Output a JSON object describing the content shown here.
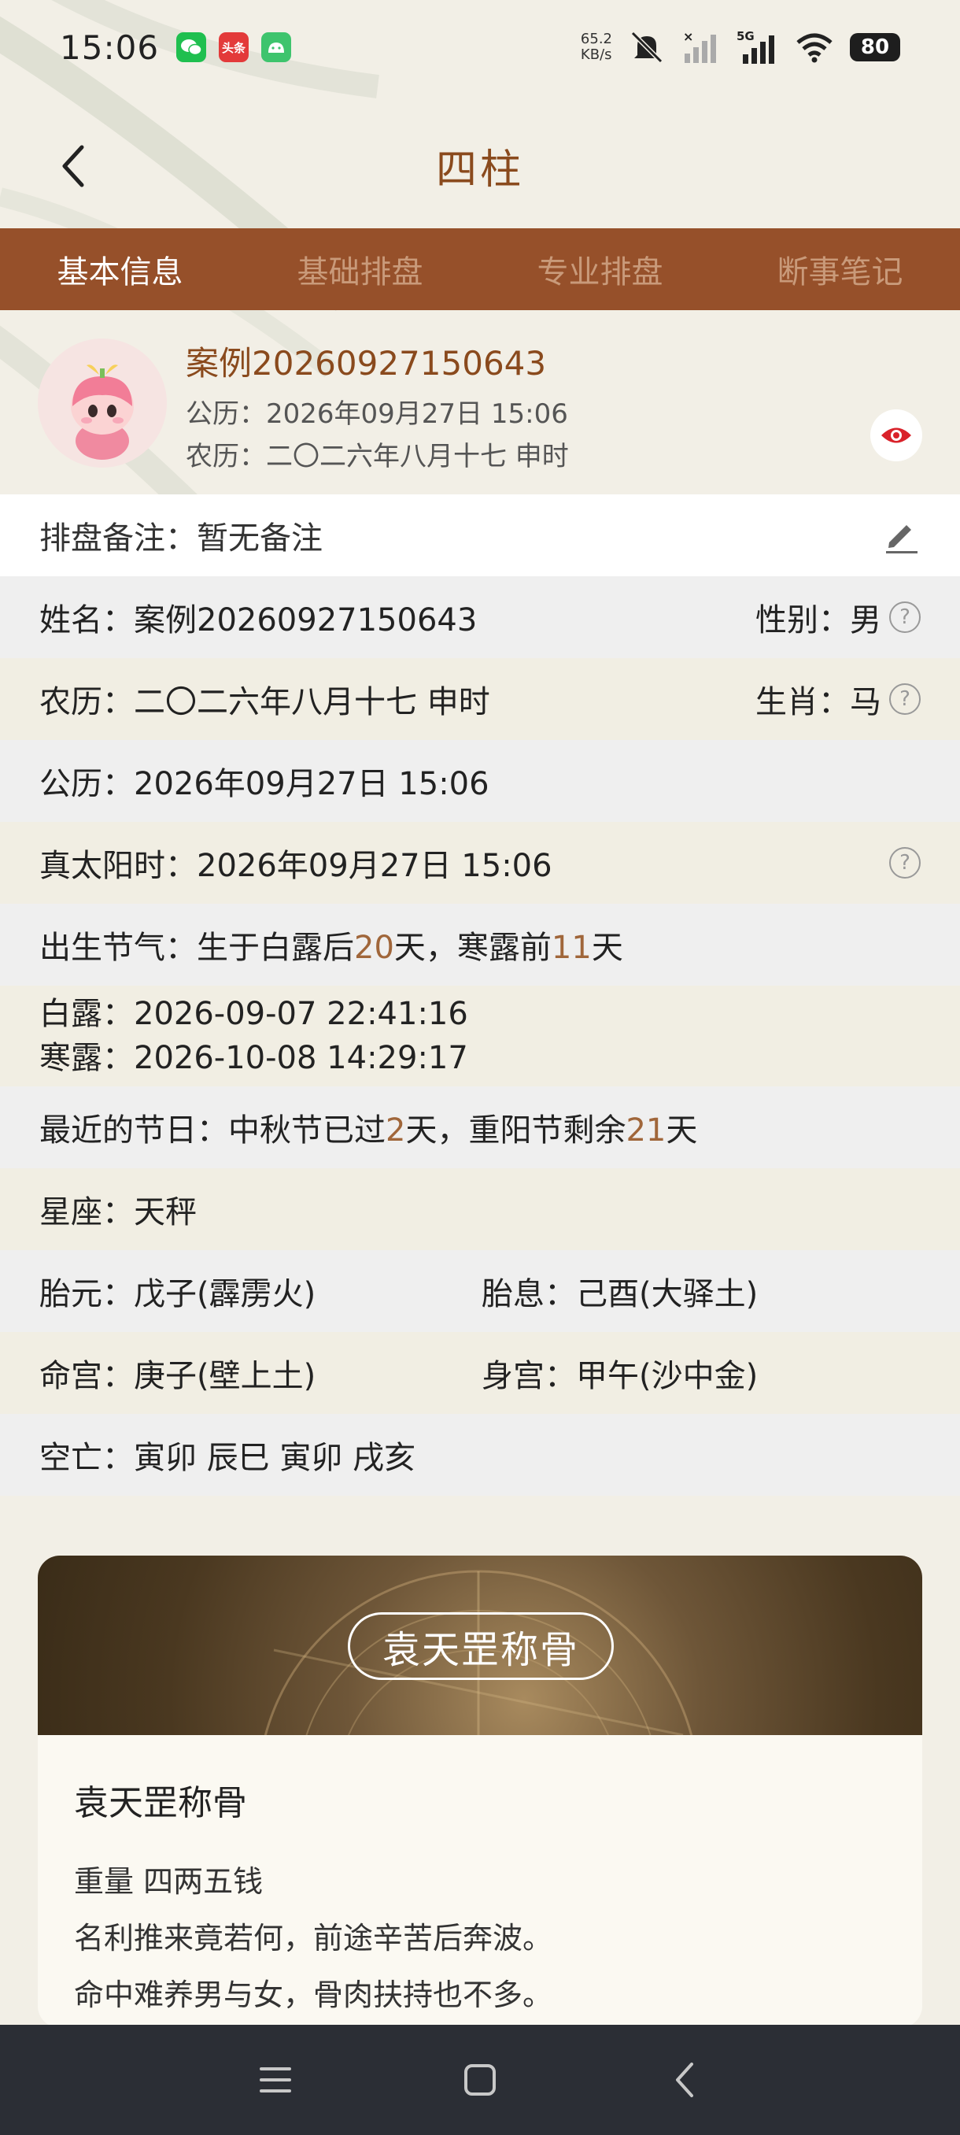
{
  "status_bar": {
    "time": "15:06",
    "net_speed_value": "65.2",
    "net_speed_unit": "KB/s",
    "network": "5G",
    "battery": "80",
    "app_icons": [
      "wechat-icon",
      "toutiao-icon",
      "android-icon"
    ],
    "toutiao_label": "头条"
  },
  "header": {
    "title": "四柱"
  },
  "tabs": [
    {
      "label": "基本信息",
      "active": true
    },
    {
      "label": "基础排盘",
      "active": false
    },
    {
      "label": "专业排盘",
      "active": false
    },
    {
      "label": "断事笔记",
      "active": false
    }
  ],
  "profile": {
    "case_name": "案例20260927150643",
    "solar": "公历：2026年09月27日 15:06",
    "lunar": "农历：二〇二六年八月十七 申时"
  },
  "note": {
    "text": "排盘备注：暂无备注"
  },
  "info": {
    "name": "姓名：案例20260927150643",
    "gender": "性别：男",
    "lunar": "农历：二〇二六年八月十七 申时",
    "zodiac": "生肖：马",
    "solar": "公历：2026年09月27日 15:06",
    "true_solar": "真太阳时：2026年09月27日 15:06",
    "jieqi_prefix": "出生节气：生于白露后",
    "jieqi_days_after": "20",
    "jieqi_mid": "天，寒露前",
    "jieqi_days_before": "11",
    "jieqi_suffix": "天",
    "bailu": "白露：2026-09-07 22:41:16",
    "hanlu": "寒露：2026-10-08 14:29:17",
    "festival_prefix": "最近的节日：中秋节已过",
    "festival_days_past": "2",
    "festival_mid": "天，重阳节剩余",
    "festival_days_left": "21",
    "festival_suffix": "天",
    "constellation": "星座：天秤",
    "taiyuan": "胎元：戊子(霹雳火)",
    "taixi": "胎息：己酉(大驿土)",
    "minggong": "命宫：庚子(壁上土)",
    "shengong": "身宫：甲午(沙中金)",
    "kongwang": "空亡：寅卯 辰巳 寅卯 戌亥"
  },
  "card": {
    "banner": "袁天罡称骨",
    "title": "袁天罡称骨",
    "weight": "重量  四两五钱",
    "line1": "名利推来竟若何，前途辛苦后奔波。",
    "line2": "命中难养男与女，骨肉扶持也不多。"
  },
  "colors": {
    "tab_bar": "#96502a",
    "accent": "#8a4a1d",
    "highlight": "#a0663a",
    "eye": "#d9222a",
    "nav_bar": "#2b2e35"
  }
}
